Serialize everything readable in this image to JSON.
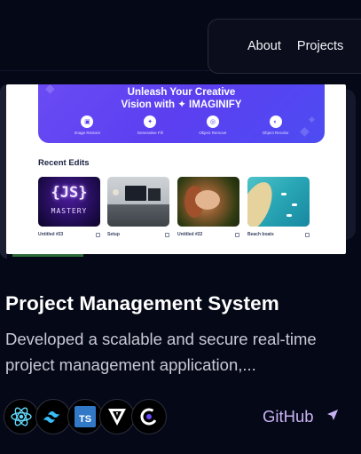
{
  "nav": {
    "links": [
      {
        "label": "About"
      },
      {
        "label": "Projects"
      }
    ]
  },
  "project": {
    "thumbnail": {
      "banner_title_line1": "Unleash Your Creative",
      "banner_title_line2": "Vision with ✦ IMAGINIFY",
      "banner_actions": [
        "Image Restore",
        "Generative Fill",
        "Object Remove",
        "Object Recolor"
      ],
      "section_title": "Recent Edits",
      "tiles": [
        {
          "caption": "Untitled #23",
          "art_text_1": "{JS}",
          "art_text_2": "MASTERY"
        },
        {
          "caption": "Setup"
        },
        {
          "caption": "Untitled #22"
        },
        {
          "caption": "Beach boats"
        }
      ]
    },
    "title": "Project Management System",
    "description": "Developed a scalable and secure real-time project management application,...",
    "tech_icons": [
      "react-icon",
      "tailwind-icon",
      "typescript-icon",
      "vite-icon",
      "clerk-icon"
    ],
    "typescript_badge": "TS",
    "link_label": "GitHub",
    "link_icon": "send-arrow-icon"
  },
  "colors": {
    "background": "#050816",
    "accent": "#c9b2f3",
    "banner": "#5b3ff0"
  }
}
